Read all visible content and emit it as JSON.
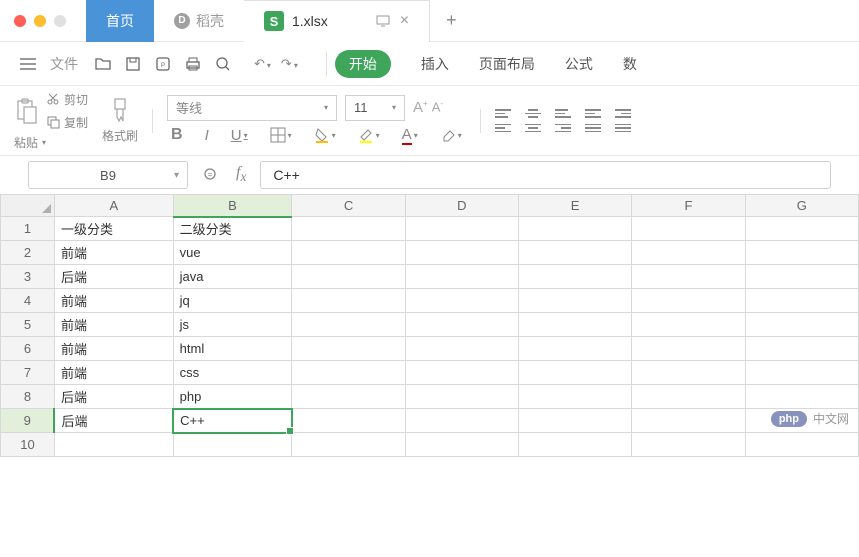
{
  "titlebar": {
    "home_tab": "首页",
    "daoke_tab": "稻壳",
    "file_tab": "1.xlsx"
  },
  "menu": {
    "file": "文件",
    "start": "开始",
    "insert": "插入",
    "layout": "页面布局",
    "formula": "公式",
    "data": "数"
  },
  "ribbon": {
    "paste": "粘贴",
    "cut": "剪切",
    "copy": "复制",
    "format_brush": "格式刷",
    "font_name": "等线",
    "font_size": "11"
  },
  "formula_bar": {
    "cell_ref": "B9",
    "value": "C++"
  },
  "columns": [
    "A",
    "B",
    "C",
    "D",
    "E",
    "F",
    "G"
  ],
  "rows": [
    {
      "num": "1",
      "A": "一级分类",
      "B": "二级分类"
    },
    {
      "num": "2",
      "A": "前端",
      "B": "vue"
    },
    {
      "num": "3",
      "A": "后端",
      "B": "java"
    },
    {
      "num": "4",
      "A": "前端",
      "B": "jq"
    },
    {
      "num": "5",
      "A": "前端",
      "B": "js"
    },
    {
      "num": "6",
      "A": "前端",
      "B": "html"
    },
    {
      "num": "7",
      "A": "前端",
      "B": "css"
    },
    {
      "num": "8",
      "A": "后端",
      "B": "php"
    },
    {
      "num": "9",
      "A": "后端",
      "B": "C++"
    },
    {
      "num": "10",
      "A": "",
      "B": ""
    }
  ],
  "watermark": {
    "badge": "php",
    "text": "中文网"
  }
}
